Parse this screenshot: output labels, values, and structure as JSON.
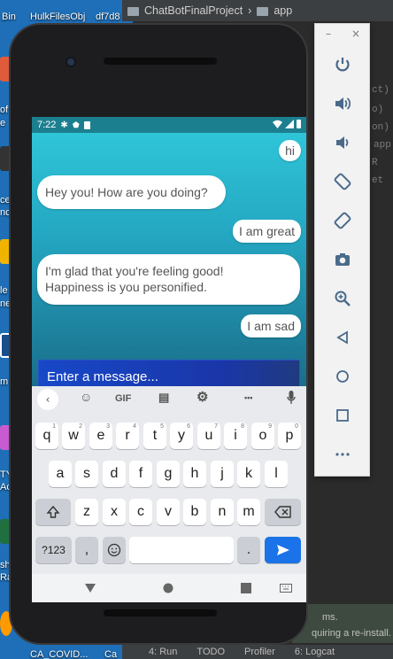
{
  "desktop": {
    "labels": [
      "Bin",
      "HulkFilesObj",
      "df7d8",
      "of",
      "e",
      "ce",
      "nc",
      "le",
      "ne",
      "m",
      "TY",
      "Ac",
      "sh",
      "RaS",
      "CA_COVID...",
      "Ca"
    ]
  },
  "ide": {
    "project": "ChatBotFinalProject",
    "module": "app",
    "side_text": [
      "ct)",
      "o)",
      "on)",
      "app",
      "R",
      "et"
    ],
    "message_line1": "ms.",
    "message_line2": "quiring a re-install.",
    "bottom_tabs": [
      "4: Run",
      "TODO",
      "Profiler",
      "6: Logcat"
    ]
  },
  "emulator": {
    "minimize": "–",
    "close": "×",
    "buttons": [
      "power-icon",
      "volume-up-icon",
      "volume-down-icon",
      "rotate-left-icon",
      "rotate-right-icon",
      "camera-icon",
      "zoom-icon",
      "back-icon",
      "home-icon",
      "overview-icon",
      "more-icon"
    ]
  },
  "status": {
    "time": "7:22"
  },
  "chat": {
    "messages": [
      {
        "side": "user",
        "text": "hi"
      },
      {
        "side": "bot",
        "text": "Hey you! How are you doing?"
      },
      {
        "side": "user",
        "text": "I am great"
      },
      {
        "side": "bot",
        "text": "I'm glad that you're feeling good!\nHappiness is you personified."
      },
      {
        "side": "user",
        "text": "I am sad"
      }
    ],
    "input_placeholder": "Enter a message..."
  },
  "keyboard": {
    "toolbar": {
      "gif": "GIF",
      "more": "•••"
    },
    "row1": [
      "q",
      "w",
      "e",
      "r",
      "t",
      "y",
      "u",
      "i",
      "o",
      "p"
    ],
    "row1_hints": [
      "1",
      "2",
      "3",
      "4",
      "5",
      "6",
      "7",
      "8",
      "9",
      "0"
    ],
    "row2": [
      "a",
      "s",
      "d",
      "f",
      "g",
      "h",
      "j",
      "k",
      "l"
    ],
    "row3": [
      "z",
      "x",
      "c",
      "v",
      "b",
      "n",
      "m"
    ],
    "symbols_key": "?123",
    "comma_key": ",",
    "period_key": "."
  },
  "colors": {
    "chat_gradient_top": "#2fc5d8",
    "chat_gradient_bottom": "#1a6e8a",
    "input_bar": "#1748c8",
    "send_button": "#1a73e8",
    "status_bar": "#1c7f8f"
  }
}
